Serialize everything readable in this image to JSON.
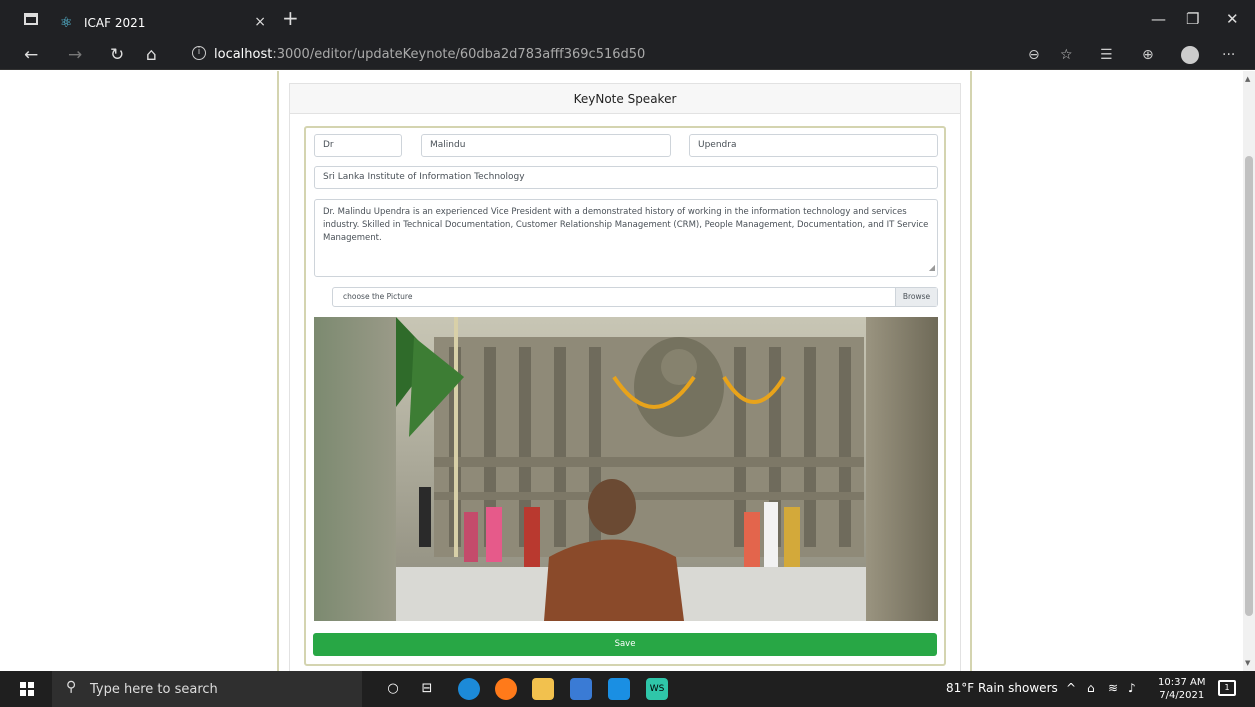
{
  "browser": {
    "tab_title": "ICAF 2021",
    "tab_close": "×",
    "new_tab": "+",
    "url_host": "localhost",
    "url_rest": ":3000/editor/updateKeynote/60dba2d783afff369c516d50"
  },
  "page": {
    "card_header": "KeyNote Speaker",
    "title_value": "Dr",
    "first_name_value": "Malindu",
    "last_name_value": "Upendra",
    "institution_value": "Sri Lanka Institute of Information Technology",
    "bio_value": "Dr. Malindu Upendra is an experienced Vice President with a demonstrated history of working in the information technology and services industry. Skilled in Technical Documentation, Customer Relationship Management (CRM), People Management, Documentation, and IT Service Management.",
    "file_label": "choose the Picture",
    "browse_label": "Browse",
    "save_label": "Save"
  },
  "taskbar": {
    "search_placeholder": "Type here to search",
    "weather": "81°F  Rain showers",
    "time": "10:37 AM",
    "date": "7/4/2021",
    "notif_count": "1"
  },
  "colors": {
    "save_button": "#28a745",
    "chrome_dark": "#202124",
    "card_border": "#d4d4b0"
  }
}
